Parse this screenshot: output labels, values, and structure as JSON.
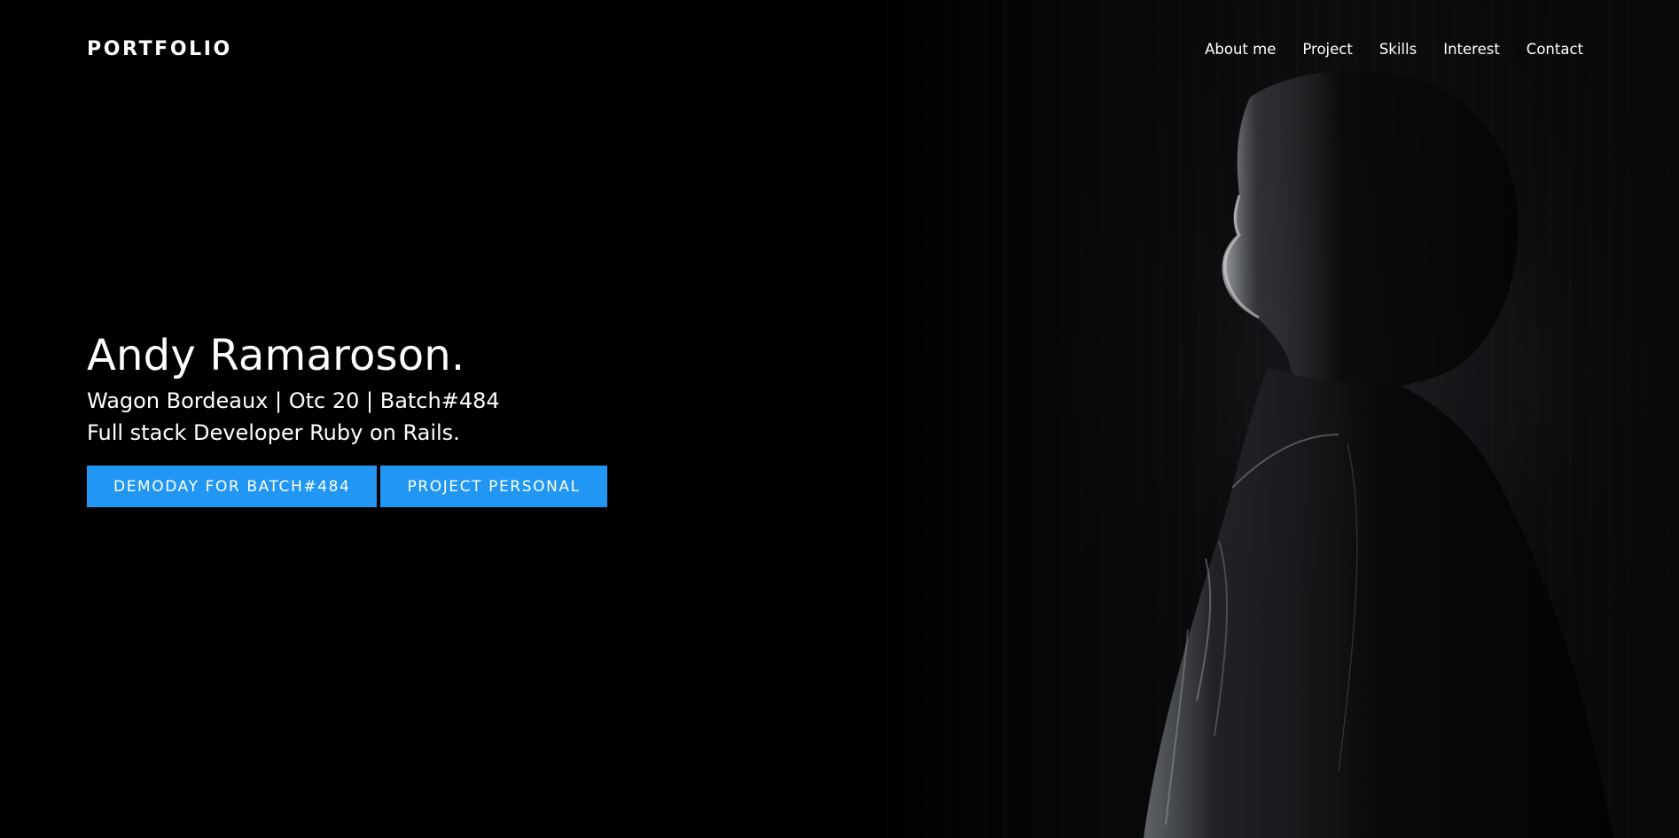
{
  "nav": {
    "brand": "PORTFOLIO",
    "links": [
      "About me",
      "Project",
      "Skills",
      "Interest",
      "Contact"
    ]
  },
  "hero": {
    "title": "Andy Ramaroson.",
    "subtitle": "Wagon Bordeaux | Otc 20 | Batch#484",
    "role": "Full stack Developer Ruby on Rails.",
    "buttons": [
      "DEMODAY FOR BATCH#484",
      "PROJECT PERSONAL"
    ]
  },
  "colors": {
    "background": "#000000",
    "accent": "#2196f3",
    "text": "#ffffff"
  }
}
